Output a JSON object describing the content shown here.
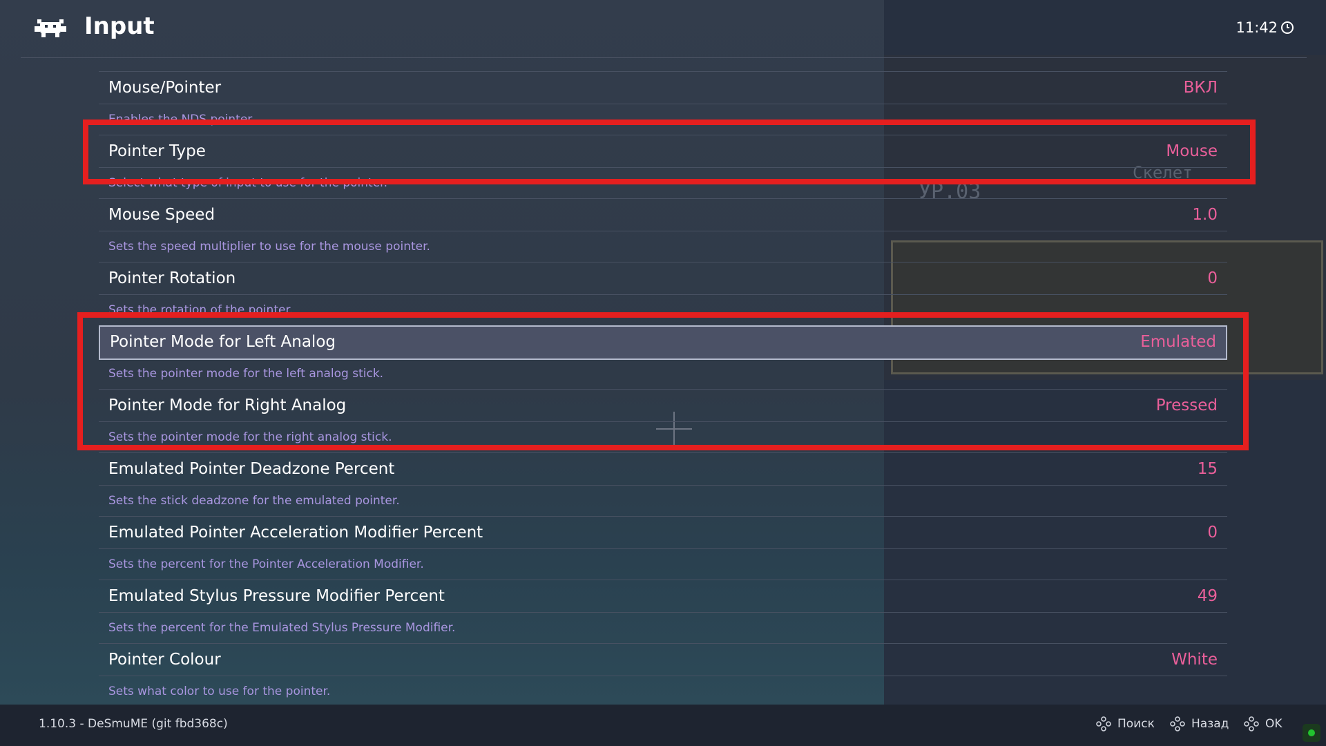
{
  "header": {
    "title": "Input",
    "clock": "11:42"
  },
  "settings": [
    {
      "label": "Mouse/Pointer",
      "value": "ВКЛ",
      "desc": "Enables the NDS pointer."
    },
    {
      "label": "Pointer Type",
      "value": "Mouse",
      "desc": "Select what type of input to use for the pointer."
    },
    {
      "label": "Mouse Speed",
      "value": "1.0",
      "desc": "Sets the speed multiplier to use for the mouse pointer."
    },
    {
      "label": "Pointer Rotation",
      "value": "0",
      "desc": "Sets the rotation of the pointer."
    },
    {
      "label": "Pointer Mode for Left Analog",
      "value": "Emulated",
      "desc": "Sets the pointer mode for the left analog stick."
    },
    {
      "label": "Pointer Mode for Right Analog",
      "value": "Pressed",
      "desc": "Sets the pointer mode for the right analog stick."
    },
    {
      "label": "Emulated Pointer Deadzone Percent",
      "value": "15",
      "desc": "Sets the stick deadzone for the emulated pointer."
    },
    {
      "label": "Emulated Pointer Acceleration Modifier Percent",
      "value": "0",
      "desc": "Sets the percent for the Pointer Acceleration Modifier."
    },
    {
      "label": "Emulated Stylus Pressure Modifier Percent",
      "value": "49",
      "desc": "Sets the percent for the Emulated Stylus Pressure Modifier."
    },
    {
      "label": "Pointer Colour",
      "value": "White",
      "desc": "Sets what color to use for the pointer."
    }
  ],
  "selected_index": 4,
  "footer": {
    "version": "1.10.3 - DeSmuME (git fbd368c)",
    "search_label": "Поиск",
    "back_label": "Назад",
    "ok_label": "OK"
  },
  "colors": {
    "value": "#ea5f9a",
    "description": "#a996e0",
    "highlight_box": "#e51f1f",
    "status": "#22c32f"
  }
}
